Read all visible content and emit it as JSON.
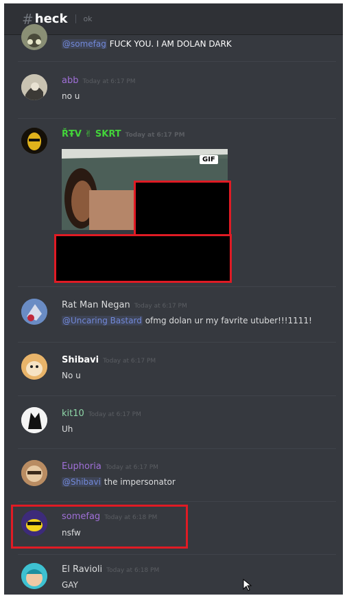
{
  "channel": {
    "hash": "#",
    "name": "heck",
    "topic": "ok"
  },
  "messages": [
    {
      "username": "",
      "timestamp": "",
      "mention": "@somefag",
      "text": "FUCK YOU. I AM DOLAN DARK",
      "color": "#ffffff"
    },
    {
      "username": "abb",
      "timestamp": "Today at 6:17 PM",
      "text": "no u",
      "color": "#a070d8"
    },
    {
      "username": "ŘŦV ✌ SKRT",
      "timestamp": "Today at 6:17 PM",
      "text": "",
      "color": "#43d33a",
      "attachment": "GIF"
    },
    {
      "username": "Rat Man Negan",
      "timestamp": "Today at 6:17 PM",
      "mention": "@Uncaring Bastard",
      "text": "ofmg dolan ur my favrite utuber!!!1111!",
      "color": "#dcddde"
    },
    {
      "username": "Shibavi",
      "timestamp": "Today at 6:17 PM",
      "text": "No u",
      "color": "#ffffff"
    },
    {
      "username": "kit10",
      "timestamp": "Today at 6:17 PM",
      "text": "Uh",
      "color": "#8fd7a8"
    },
    {
      "username": "Euphoria",
      "timestamp": "Today at 6:17 PM",
      "mention": "@Shibavi",
      "text": "the impersonator",
      "color": "#a070d8"
    },
    {
      "username": "somefag",
      "timestamp": "Today at 6:18 PM",
      "text": "nsfw",
      "color": "#a070d8"
    },
    {
      "username": "El Ravioli",
      "timestamp": "Today at 6:18 PM",
      "text": "GAY",
      "color": "#dcddde"
    }
  ],
  "colors": {
    "highlight": "#e01b24",
    "redacted": "#000000",
    "bg": "#36393f"
  }
}
